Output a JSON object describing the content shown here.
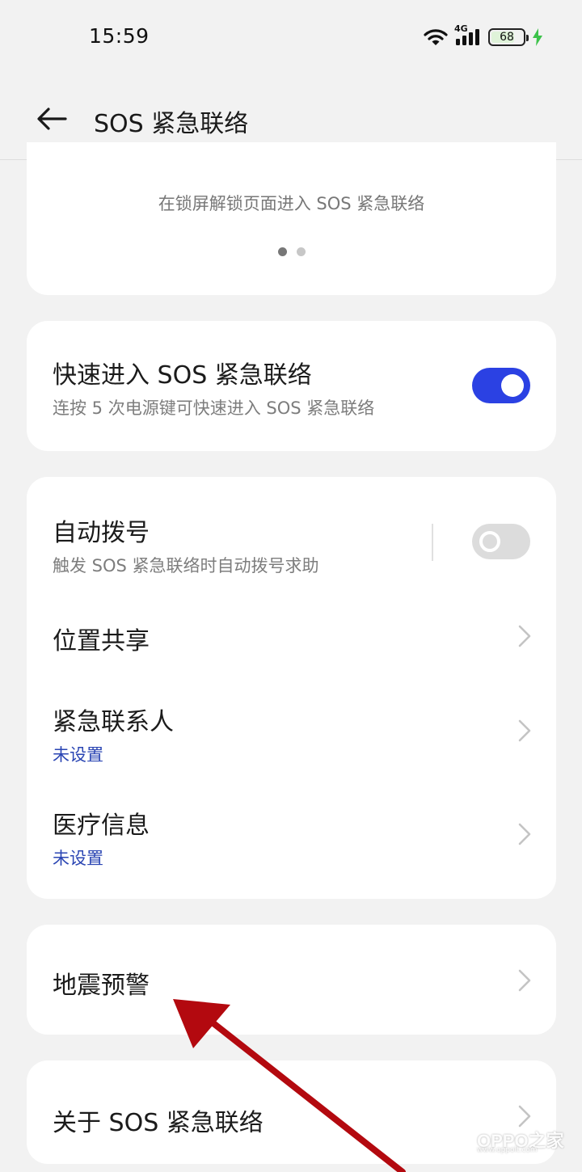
{
  "status_bar": {
    "time": "15:59",
    "network": "4G",
    "battery": "68",
    "icons": [
      "wifi-icon",
      "signal-icon",
      "battery-icon",
      "charging-bolt-icon"
    ]
  },
  "header": {
    "title": "SOS 紧急联络",
    "back_icon": "back-arrow-icon"
  },
  "carousel": {
    "caption": "在锁屏解锁页面进入 SOS 紧急联络",
    "page_count": 2,
    "active_page": 1
  },
  "quick_entry": {
    "title": "快速进入 SOS 紧急联络",
    "subtitle": "连按 5 次电源键可快速进入 SOS 紧急联络",
    "enabled": true
  },
  "settings": {
    "auto_dial": {
      "title": "自动拨号",
      "subtitle": "触发 SOS 紧急联络时自动拨号求助",
      "enabled": false
    },
    "location_sharing": {
      "title": "位置共享"
    },
    "emergency_contacts": {
      "title": "紧急联系人",
      "status": "未设置"
    },
    "medical_info": {
      "title": "医疗信息",
      "status": "未设置"
    }
  },
  "earthquake_warning": {
    "title": "地震预警"
  },
  "about": {
    "title": "关于 SOS 紧急联络"
  },
  "watermark": {
    "brand": "OPPO之家",
    "url": "www.oppolt.com"
  },
  "colors": {
    "accent": "#2b41e3",
    "link": "#2a45b3",
    "background": "#f2f2f2",
    "annotation_arrow": "#b3090f"
  }
}
